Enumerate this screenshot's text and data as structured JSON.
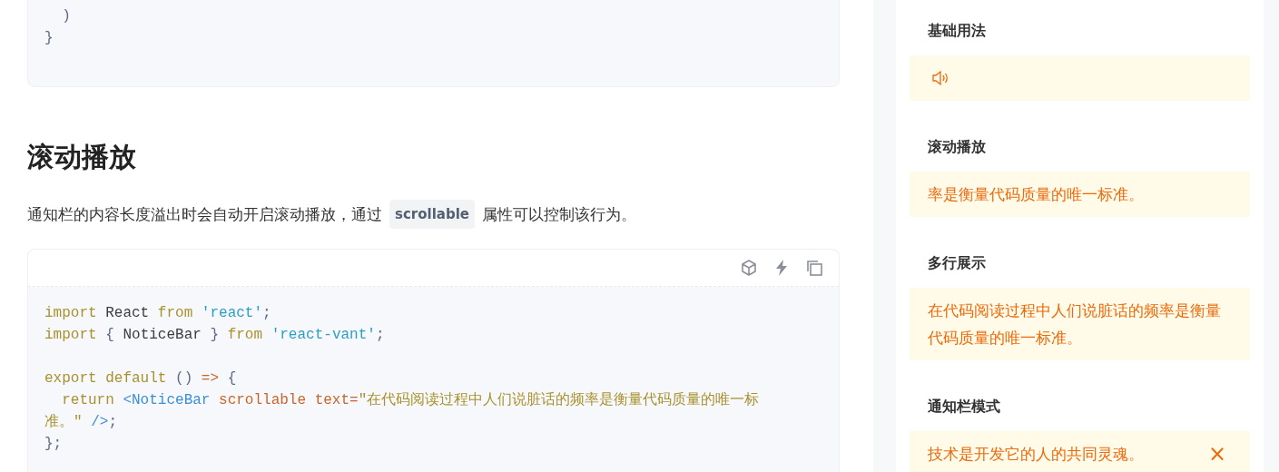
{
  "previous_code": {
    "lines": [
      [
        {
          "kind": "punct",
          "text": "  )"
        }
      ],
      [
        {
          "kind": "punct",
          "text": "}"
        }
      ]
    ]
  },
  "section": {
    "title": "滚动播放",
    "description": {
      "before": "通知栏的内容长度溢出时会自动开启滚动播放，通过",
      "code": "scrollable",
      "after": "属性可以控制该行为。"
    }
  },
  "code_block": {
    "lines": [
      {
        "kind": "code",
        "tokens": [
          {
            "kind": "kw",
            "text": "import"
          },
          {
            "kind": "plain",
            "text": " React "
          },
          {
            "kind": "kw",
            "text": "from"
          },
          {
            "kind": "str",
            "text": " 'react'"
          },
          {
            "kind": "punct",
            "text": ";"
          }
        ]
      },
      {
        "kind": "code",
        "tokens": [
          {
            "kind": "kw",
            "text": "import"
          },
          {
            "kind": "punct",
            "text": " { "
          },
          {
            "kind": "plain",
            "text": "NoticeBar"
          },
          {
            "kind": "punct",
            "text": " } "
          },
          {
            "kind": "kw",
            "text": "from"
          },
          {
            "kind": "str",
            "text": " 'react-vant'"
          },
          {
            "kind": "punct",
            "text": ";"
          }
        ]
      },
      {
        "kind": "blank"
      },
      {
        "kind": "code",
        "tokens": [
          {
            "kind": "kw",
            "text": "export default"
          },
          {
            "kind": "punct",
            "text": " () "
          },
          {
            "kind": "attr",
            "text": "=>"
          },
          {
            "kind": "punct",
            "text": " {"
          }
        ]
      },
      {
        "kind": "code",
        "tokens": [
          {
            "kind": "kw",
            "text": "  return"
          },
          {
            "kind": "tag",
            "text": " <NoticeBar"
          },
          {
            "kind": "attr",
            "text": " scrollable text="
          },
          {
            "kind": "kw",
            "text": "\"在代码阅读过程中人们说脏话的频率是衡量代码质量的唯一标"
          }
        ]
      },
      {
        "kind": "code",
        "tokens": [
          {
            "kind": "kw",
            "text": "准。\""
          },
          {
            "kind": "tag",
            "text": " />"
          },
          {
            "kind": "punct",
            "text": ";"
          }
        ]
      },
      {
        "kind": "code",
        "tokens": [
          {
            "kind": "punct",
            "text": "};"
          }
        ]
      }
    ]
  },
  "demo": {
    "sections": [
      {
        "title": "基础用法",
        "notice": {
          "kind": "icon"
        }
      },
      {
        "title": "滚动播放",
        "notice": {
          "kind": "scroll",
          "text": "率是衡量代码质量的唯一标准。"
        }
      },
      {
        "title": "多行展示",
        "notice": {
          "kind": "multiline",
          "text": "在代码阅读过程中人们说脏话的频率是衡量代码质量的唯一标准。"
        }
      },
      {
        "title": "通知栏模式",
        "notice": {
          "kind": "closeable",
          "text": "技术是开发它的人的共同灵魂。",
          "close": "×"
        }
      }
    ]
  }
}
